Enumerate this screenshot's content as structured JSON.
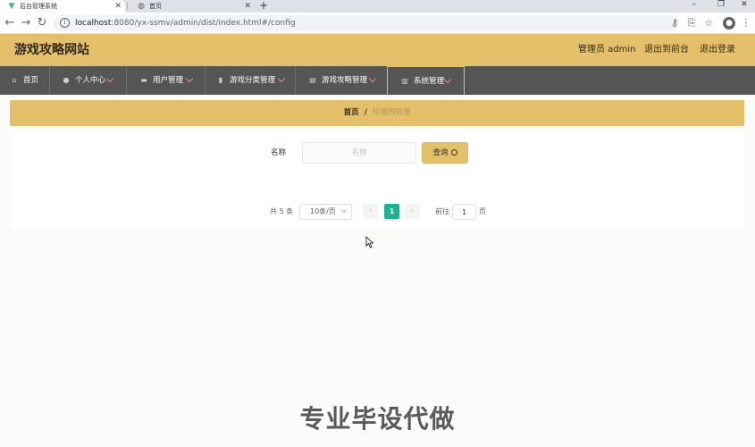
{
  "browser": {
    "tabs": [
      {
        "title": "后台管理系统",
        "active": true
      },
      {
        "title": "首页",
        "active": false
      }
    ],
    "new_tab": "+",
    "url_host": "localhost",
    "url_path": ":8080/yx-ssmv/admin/dist/index.html#/config"
  },
  "header": {
    "title": "游戏攻略网站",
    "admin_label": "管理员 admin",
    "to_front": "退出到前台",
    "logout": "退出登录"
  },
  "nav": {
    "items": [
      {
        "label": "首页",
        "icon": "home-icon"
      },
      {
        "label": "个人中心",
        "icon": "user-icon"
      },
      {
        "label": "用户管理",
        "icon": "briefcase-icon"
      },
      {
        "label": "游戏分类管理",
        "icon": "books-icon"
      },
      {
        "label": "游戏攻略管理",
        "icon": "document-icon"
      },
      {
        "label": "系统管理",
        "icon": "file-icon"
      }
    ]
  },
  "breadcrumb": {
    "home": "首页",
    "separator": "/",
    "current": "轮播图管理"
  },
  "search": {
    "label": "名称",
    "placeholder": "名称",
    "button": "查询"
  },
  "pagination": {
    "total": "共 5 条",
    "page_size": "10条/页",
    "current_page": "1",
    "goto_label": "前往",
    "goto_value": "1",
    "unit": "页"
  },
  "watermark": "专业毕设代做",
  "colors": {
    "accent": "#e5c06a",
    "nav_bg": "#555555",
    "active_page": "#1db393"
  }
}
